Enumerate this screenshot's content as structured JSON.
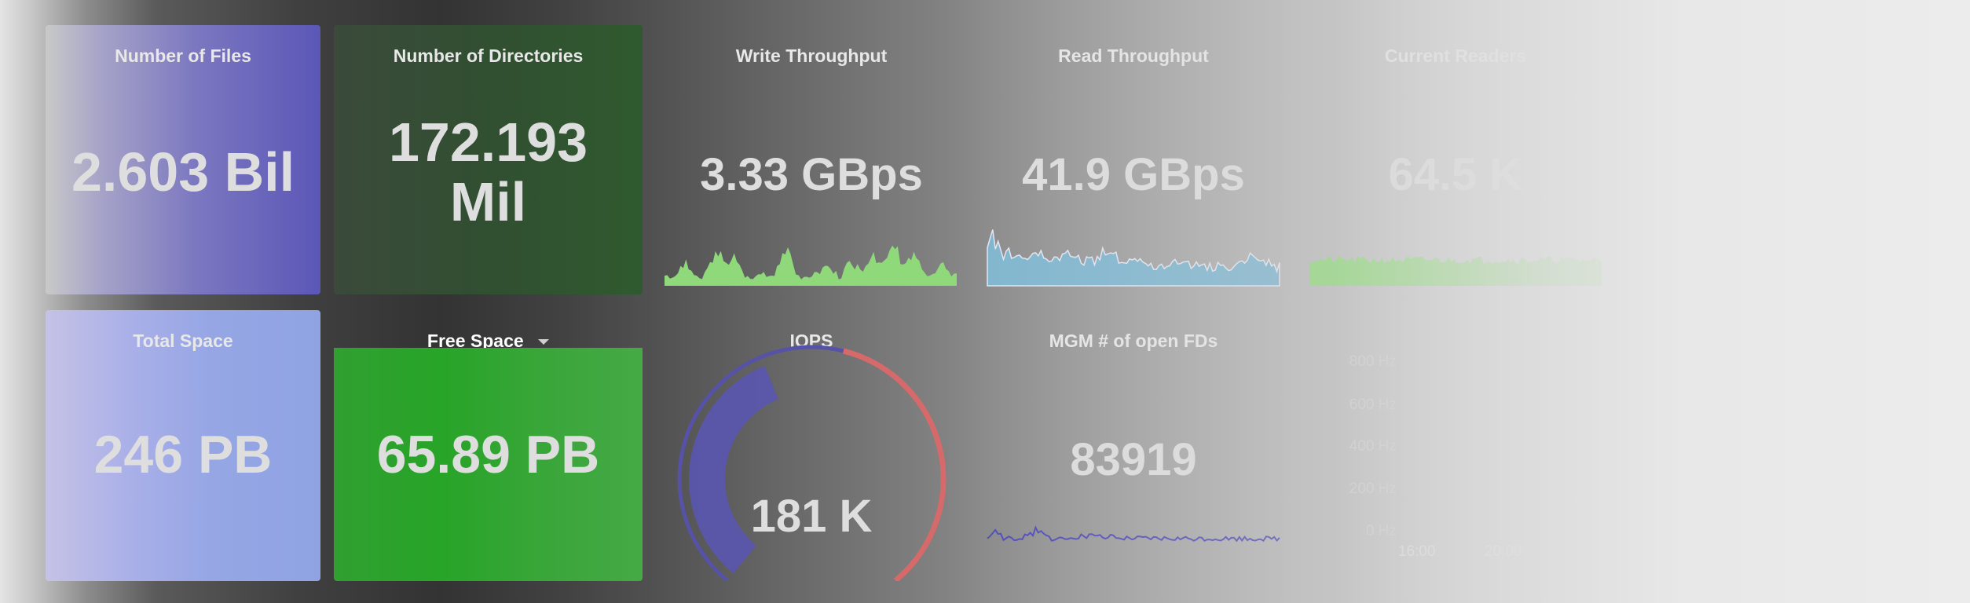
{
  "panels": {
    "files": {
      "title": "Number of Files",
      "value": "2.603 Bil"
    },
    "directories": {
      "title": "Number of Directories",
      "value_line1": "172.193",
      "value_line2": "Mil"
    },
    "write_throughput": {
      "title": "Write Throughput",
      "value": "3.33 GBps",
      "spark_color": "#8fd97a"
    },
    "read_throughput": {
      "title": "Read Throughput",
      "value": "41.9 GBps",
      "spark_color": "#7fb6cf"
    },
    "current_readers": {
      "title": "Current Readers",
      "value": "64.5 K",
      "spark_color": "#8fd97a"
    },
    "total_space": {
      "title": "Total Space",
      "value": "246 PB"
    },
    "free_space": {
      "title": "Free Space",
      "value": "65.89 PB",
      "menu_icon": "caret-down-icon"
    },
    "iops": {
      "title": "IOPS",
      "value": "181 K",
      "gauge_fraction": 0.42,
      "threshold_color": "#d6696a",
      "fill_color": "#5a56b0"
    },
    "mgm_open_fds": {
      "title": "MGM # of open FDs",
      "value": "83919"
    }
  },
  "hz_chart": {
    "y_ticks": [
      "800 Hz",
      "600 Hz",
      "400 Hz",
      "200 Hz",
      "0 Hz"
    ],
    "x_ticks": [
      "16:00",
      "20:00"
    ]
  },
  "colors": {
    "purple": "#5b57b7",
    "dark_green": "#2f5a2f",
    "periwinkle": "#8fa3e3",
    "bright_green": "#33a833"
  }
}
